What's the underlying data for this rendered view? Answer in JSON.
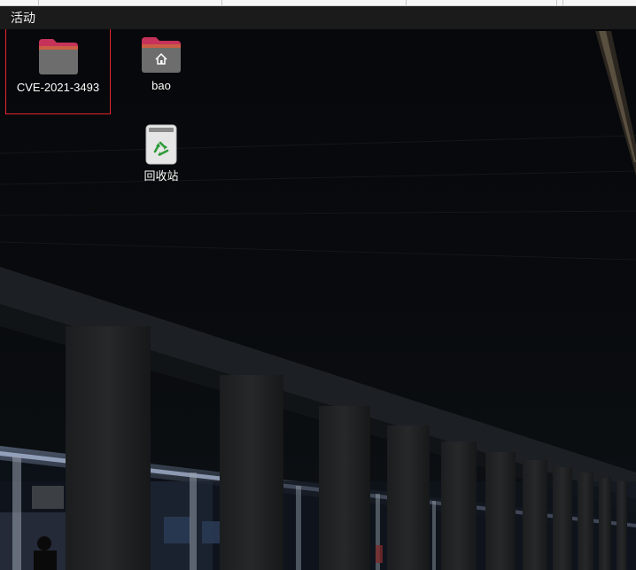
{
  "topbar": {
    "activities_label": "活动"
  },
  "desktop": {
    "icons": [
      {
        "label": "CVE-2021-3493",
        "icon": "folder-icon",
        "selected": true
      },
      {
        "label": "bao",
        "icon": "home-folder-icon",
        "selected": false
      },
      {
        "label": "回收站",
        "icon": "trash-icon",
        "selected": false
      }
    ]
  },
  "colors": {
    "topbar_bg": "#1b1b1b",
    "selection_border": "#e4252d",
    "folder_tab": "#c7325b",
    "folder_body": "#6d6d6d",
    "recycle_green": "#2f9a3a"
  }
}
